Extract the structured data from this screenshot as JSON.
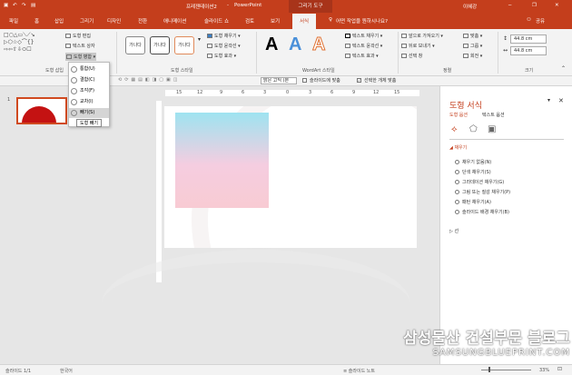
{
  "titlebar": {
    "save_icon": "save-icon",
    "undo_icon": "undo-icon",
    "redo_icon": "redo-icon",
    "present_icon": "present-icon",
    "document": "프레젠테이션2",
    "separator": "-",
    "app": "PowerPoint",
    "tool_tab": "그리기 도구",
    "user": "이혜강",
    "window_controls": [
      "─",
      "❐",
      "✕"
    ]
  },
  "tabs": [
    "파일",
    "홈",
    "삽입",
    "그리기",
    "디자인",
    "전환",
    "애니메이션",
    "슬라이드 쇼",
    "검토",
    "보기",
    "서식"
  ],
  "tell_me": "어떤 작업을 원하시나요?",
  "share": "공유",
  "ribbon": {
    "insert_shapes": {
      "edit_shape": "도형 편집",
      "text_box": "텍스트 상자",
      "merge_shapes": "도형 병합",
      "label": "도형 삽입"
    },
    "shape_styles": {
      "sample": "가나다",
      "fill": "도형 채우기",
      "outline": "도형 윤곽선",
      "effects": "도형 효과",
      "label": "도형 스타일"
    },
    "wordart": {
      "sample": "A",
      "text_fill": "텍스트 채우기",
      "text_outline": "텍스트 윤곽선",
      "text_effects": "텍스트 효과",
      "label": "WordArt 스타일"
    },
    "arrange": {
      "bring_forward": "앞으로 가져오기",
      "send_backward": "뒤로 보내기",
      "selection_pane": "선택 창",
      "align": "맞춤",
      "group": "그룹",
      "rotate": "회전",
      "label": "정렬"
    },
    "size": {
      "height": "44.8 cm",
      "width": "44.8 cm",
      "label": "크기"
    }
  },
  "toolbar2": {
    "font": "맑은 고딕 (본",
    "slide_fit": "슬라이드에 맞춤",
    "selected_fit": "선택한 개체 맞춤"
  },
  "merge_menu": [
    "통합(U)",
    "결합(C)",
    "조각(F)",
    "교차(I)",
    "빼기(S)"
  ],
  "tooltip": "도형 빼기",
  "slides": {
    "number": "1"
  },
  "ruler": [
    "15",
    "12",
    "9",
    "6",
    "3",
    "0",
    "3",
    "6",
    "9",
    "12",
    "15"
  ],
  "pane": {
    "title": "도형 서식",
    "tab_shape": "도형 옵션",
    "tab_text": "텍스트 옵션",
    "section_fill": "채우기",
    "fill_options": [
      "채우기 없음(N)",
      "단색 채우기(S)",
      "그라데이션 채우기(G)",
      "그림 또는 질감 채우기(P)",
      "패턴 채우기(A)",
      "슬라이드 배경 채우기(B)"
    ],
    "section_line": "선"
  },
  "status": {
    "slide": "슬라이드 1/1",
    "language": "한국어",
    "notes": "슬라이드 노트",
    "zoom": "33%"
  },
  "watermark": {
    "title": "삼성물산 건설부문 블로그",
    "url": "SAMSUNGBLUEPRINT.COM"
  }
}
